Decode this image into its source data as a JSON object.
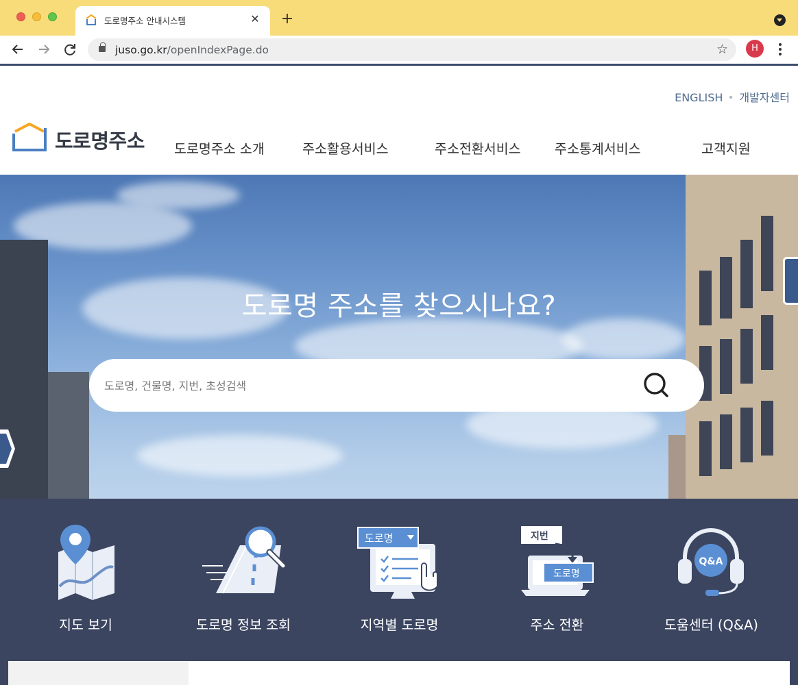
{
  "browser": {
    "tab_title": "도로명주소 안내시스템",
    "tab_close": "✕",
    "new_tab": "+",
    "url_host": "juso.go.kr",
    "url_path": "/openIndexPage.do",
    "profile_initial": "H",
    "star": "☆"
  },
  "header": {
    "util_links": [
      "ENGLISH",
      "개발자센터"
    ],
    "logo_text": "도로명주소",
    "nav": [
      "도로명주소 소개",
      "주소활용서비스",
      "주소전환서비스",
      "주소통계서비스",
      "고객지원"
    ]
  },
  "hero": {
    "title": "도로명 주소를 찾으시나요?",
    "search_placeholder": "도로명, 건물명, 지번, 초성검색",
    "search_value": ""
  },
  "quick_menu": {
    "items": [
      {
        "label": "지도 보기",
        "icon": "map-pin-icon"
      },
      {
        "label": "도로명 정보 조회",
        "icon": "road-search-icon"
      },
      {
        "label": "지역별 도로명",
        "icon": "region-select-icon",
        "badge": "도로명"
      },
      {
        "label": "주소 전환",
        "icon": "address-convert-icon",
        "badge_from": "지번",
        "badge_to": "도로명"
      },
      {
        "label": "도움센터 (Q&A)",
        "icon": "headset-qa-icon",
        "badge": "Q&A"
      }
    ]
  },
  "colors": {
    "tabstrip": "#f8dc7a",
    "quick_menu_bg": "#3b4560",
    "util_link": "#4f6c91",
    "logo_orange": "#f5a623",
    "logo_blue": "#4a7fc1"
  }
}
